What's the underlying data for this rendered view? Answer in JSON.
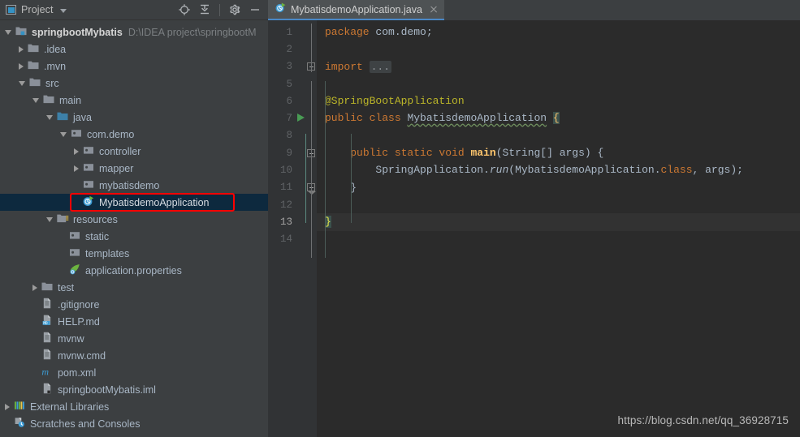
{
  "window": {
    "theme_accent": "#4a88c7",
    "editor_bg": "#2b2b2b",
    "panel_bg": "#3c3f41",
    "annotation_color": "#fe0000"
  },
  "project_panel": {
    "title": "Project",
    "title_caret": "chevron-down-icon",
    "toolbar": [
      {
        "name": "locate-in-tree-icon",
        "label": "Select Opened File"
      },
      {
        "name": "collapse-all-icon",
        "label": "Collapse All"
      },
      {
        "name": "gear-icon",
        "label": "Settings"
      },
      {
        "name": "minimize-icon",
        "label": "Hide"
      }
    ],
    "tree": [
      {
        "label": "springbootMybatis",
        "sublabel": "D:\\IDEA project\\springbootM",
        "icon": "project-module-icon",
        "indent": 0,
        "arrow": "open",
        "bold": true,
        "selected": false
      },
      {
        "label": ".idea",
        "sublabel": "",
        "icon": "folder-icon",
        "indent": 1,
        "arrow": "closed",
        "bold": false,
        "selected": false
      },
      {
        "label": ".mvn",
        "sublabel": "",
        "icon": "folder-icon",
        "indent": 1,
        "arrow": "closed",
        "bold": false,
        "selected": false
      },
      {
        "label": "src",
        "sublabel": "",
        "icon": "folder-icon",
        "indent": 1,
        "arrow": "open",
        "bold": false,
        "selected": false
      },
      {
        "label": "main",
        "sublabel": "",
        "icon": "folder-icon",
        "indent": 2,
        "arrow": "open",
        "bold": false,
        "selected": false
      },
      {
        "label": "java",
        "sublabel": "",
        "icon": "source-root-folder-icon",
        "indent": 3,
        "arrow": "open",
        "bold": false,
        "selected": false
      },
      {
        "label": "com.demo",
        "sublabel": "",
        "icon": "package-icon",
        "indent": 4,
        "arrow": "open",
        "bold": false,
        "selected": false
      },
      {
        "label": "controller",
        "sublabel": "",
        "icon": "package-icon",
        "indent": 5,
        "arrow": "closed",
        "bold": false,
        "selected": false
      },
      {
        "label": "mapper",
        "sublabel": "",
        "icon": "package-icon",
        "indent": 5,
        "arrow": "closed",
        "bold": false,
        "selected": false
      },
      {
        "label": "mybatisdemo",
        "sublabel": "",
        "icon": "package-icon",
        "indent": 5,
        "arrow": "none",
        "bold": false,
        "selected": false
      },
      {
        "label": "MybatisdemoApplication",
        "sublabel": "",
        "icon": "spring-boot-class-icon",
        "indent": 5,
        "arrow": "none",
        "bold": false,
        "selected": true
      },
      {
        "label": "resources",
        "sublabel": "",
        "icon": "resource-root-folder-icon",
        "indent": 3,
        "arrow": "open",
        "bold": false,
        "selected": false
      },
      {
        "label": "static",
        "sublabel": "",
        "icon": "package-icon",
        "indent": 4,
        "arrow": "none",
        "bold": false,
        "selected": false
      },
      {
        "label": "templates",
        "sublabel": "",
        "icon": "package-icon",
        "indent": 4,
        "arrow": "none",
        "bold": false,
        "selected": false
      },
      {
        "label": "application.properties",
        "sublabel": "",
        "icon": "spring-properties-icon",
        "indent": 4,
        "arrow": "none",
        "bold": false,
        "selected": false
      },
      {
        "label": "test",
        "sublabel": "",
        "icon": "folder-icon",
        "indent": 2,
        "arrow": "closed",
        "bold": false,
        "selected": false
      },
      {
        "label": ".gitignore",
        "sublabel": "",
        "icon": "file-icon",
        "indent": 2,
        "arrow": "none",
        "bold": false,
        "selected": false
      },
      {
        "label": "HELP.md",
        "sublabel": "",
        "icon": "markdown-file-icon",
        "indent": 2,
        "arrow": "none",
        "bold": false,
        "selected": false
      },
      {
        "label": "mvnw",
        "sublabel": "",
        "icon": "file-icon",
        "indent": 2,
        "arrow": "none",
        "bold": false,
        "selected": false
      },
      {
        "label": "mvnw.cmd",
        "sublabel": "",
        "icon": "file-icon",
        "indent": 2,
        "arrow": "none",
        "bold": false,
        "selected": false
      },
      {
        "label": "pom.xml",
        "sublabel": "",
        "icon": "maven-file-icon",
        "indent": 2,
        "arrow": "none",
        "bold": false,
        "selected": false
      },
      {
        "label": "springbootMybatis.iml",
        "sublabel": "",
        "icon": "iml-file-icon",
        "indent": 2,
        "arrow": "none",
        "bold": false,
        "selected": false
      },
      {
        "label": "External Libraries",
        "sublabel": "",
        "icon": "libraries-icon",
        "indent": 0,
        "arrow": "closed",
        "bold": false,
        "selected": false
      },
      {
        "label": "Scratches and Consoles",
        "sublabel": "",
        "icon": "scratches-icon",
        "indent": 0,
        "arrow": "none",
        "bold": false,
        "selected": false
      }
    ]
  },
  "editor": {
    "tab": {
      "name": "MybatisdemoApplication.java",
      "icon": "spring-boot-class-icon",
      "close_icon": "close-icon",
      "active": true
    },
    "line_numbers": [
      "1",
      "2",
      "3",
      "5",
      "6",
      "7",
      "8",
      "9",
      "10",
      "11",
      "12",
      "13",
      "14"
    ],
    "current_line_number": "13",
    "gutter_markers": [
      {
        "line": "3",
        "marker": "fold-expand-icon"
      },
      {
        "line": "7",
        "marker": "run-gutter-icon"
      },
      {
        "line": "9",
        "marker": "fold-collapse-icon"
      },
      {
        "line": "11",
        "marker": "fold-collapse-end-icon"
      }
    ],
    "code_lines": [
      {
        "num": "1",
        "text": "package com.demo;"
      },
      {
        "num": "2",
        "text": ""
      },
      {
        "num": "3",
        "text": "import ..."
      },
      {
        "num": "5",
        "text": ""
      },
      {
        "num": "6",
        "text": "@SpringBootApplication"
      },
      {
        "num": "7",
        "text": "public class MybatisdemoApplication {"
      },
      {
        "num": "8",
        "text": ""
      },
      {
        "num": "9",
        "text": "    public static void main(String[] args) {"
      },
      {
        "num": "10",
        "text": "        SpringApplication.run(MybatisdemoApplication.class, args);"
      },
      {
        "num": "11",
        "text": "    }"
      },
      {
        "num": "12",
        "text": ""
      },
      {
        "num": "13",
        "text": "}"
      },
      {
        "num": "14",
        "text": ""
      }
    ],
    "fold_placeholder": "..."
  },
  "watermark": "https://blog.csdn.net/qq_36928715"
}
